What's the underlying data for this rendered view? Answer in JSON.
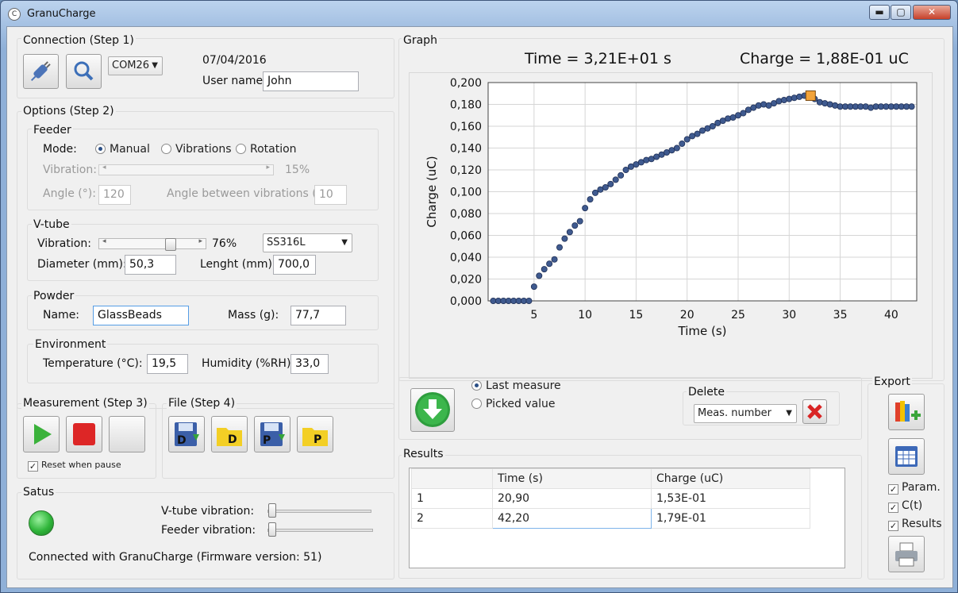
{
  "window": {
    "title": "GranuCharge",
    "icon": "app-icon",
    "min": "▬",
    "max": "▢",
    "close": "✕"
  },
  "connection": {
    "section_label": "Connection (Step 1)",
    "port": "COM26",
    "date": "07/04/2016",
    "username_label": "User name:",
    "username": "John"
  },
  "options": {
    "section_label": "Options (Step 2)",
    "feeder": {
      "label": "Feeder",
      "mode_label": "Mode:",
      "modes": [
        "Manual",
        "Vibrations",
        "Rotation"
      ],
      "selected_mode": "Manual",
      "vibration_label": "Vibration:",
      "vibration_value": "15%",
      "angle_label": "Angle (°):",
      "angle": "120",
      "angle_between_label": "Angle between vibrations (°):",
      "angle_between": "10"
    },
    "vtube": {
      "label": "V-tube",
      "vibration_label": "Vibration:",
      "vibration_value": "76%",
      "vibration_level": 0.76,
      "material": "SS316L",
      "diameter_label": "Diameter (mm):",
      "diameter": "50,3",
      "length_label": "Lenght (mm):",
      "length": "700,0"
    },
    "powder": {
      "label": "Powder",
      "name_label": "Name:",
      "name": "GlassBeads",
      "mass_label": "Mass (g):",
      "mass": "77,7"
    },
    "environment": {
      "label": "Environment",
      "temperature_label": "Temperature (°C):",
      "temperature": "19,5",
      "humidity_label": "Humidity (%RH):",
      "humidity": "33,0"
    }
  },
  "measurement": {
    "section_label": "Measurement (Step 3)",
    "reset_label": "Reset when pause",
    "reset_checked": true
  },
  "file": {
    "section_label": "File (Step 4)",
    "buttons": [
      "D",
      "D",
      "P",
      "P"
    ]
  },
  "status": {
    "section_label": "Satus",
    "vtube_vibration_label": "V-tube vibration:",
    "feeder_vibration_label": "Feeder vibration:",
    "message": "Connected with GranuCharge (Firmware version: 51)",
    "led_color": "#2fb53a"
  },
  "graph": {
    "section_label": "Graph",
    "time_readout": "Time = 3,21E+01 s",
    "charge_readout": "Charge = 1,88E-01 uC"
  },
  "chart_data": {
    "type": "scatter",
    "title": "",
    "xlabel": "Time (s)",
    "ylabel": "Charge (uC)",
    "xlim": [
      0.5,
      42.5
    ],
    "ylim": [
      0,
      0.2
    ],
    "xticks": [
      "5",
      "10",
      "15",
      "20",
      "25",
      "30",
      "35",
      "40"
    ],
    "yticks": [
      "0,000",
      "0,020",
      "0,040",
      "0,060",
      "0,080",
      "0,100",
      "0,120",
      "0,140",
      "0,160",
      "0,180",
      "0,200"
    ],
    "grid": true,
    "marker_color": "#3f5a8f",
    "highlight_color": "#f2a33a",
    "series": [
      {
        "x": [
          1.0,
          1.5,
          2.0,
          2.5,
          3.0,
          3.5,
          4.0,
          4.5,
          5.0,
          5.5,
          6.0,
          6.5,
          7.0,
          7.5,
          8.0,
          8.5,
          9.0,
          9.5,
          10.0,
          10.5,
          11.0,
          11.5,
          12.0,
          12.5,
          13.0,
          13.5,
          14.0,
          14.5,
          15.0,
          15.5,
          16.0,
          16.5,
          17.0,
          17.5,
          18.0,
          18.5,
          19.0,
          19.5,
          20.0,
          20.5,
          21.0,
          21.5,
          22.0,
          22.5,
          23.0,
          23.5,
          24.0,
          24.5,
          25.0,
          25.5,
          26.0,
          26.5,
          27.0,
          27.5,
          28.0,
          28.5,
          29.0,
          29.5,
          30.0,
          30.5,
          31.0,
          31.5,
          32.0,
          32.5,
          33.0,
          33.5,
          34.0,
          34.5,
          35.0,
          35.5,
          36.0,
          36.5,
          37.0,
          37.5,
          38.0,
          38.5,
          39.0,
          39.5,
          40.0,
          40.5,
          41.0,
          41.5,
          42.0
        ],
        "y": [
          0.0,
          0.0,
          0.0,
          0.0,
          0.0,
          0.0,
          0.0,
          0.0,
          0.013,
          0.023,
          0.029,
          0.034,
          0.038,
          0.049,
          0.057,
          0.063,
          0.069,
          0.073,
          0.085,
          0.093,
          0.099,
          0.102,
          0.104,
          0.107,
          0.111,
          0.115,
          0.12,
          0.123,
          0.125,
          0.127,
          0.129,
          0.13,
          0.132,
          0.134,
          0.136,
          0.138,
          0.14,
          0.144,
          0.148,
          0.151,
          0.153,
          0.156,
          0.158,
          0.16,
          0.163,
          0.165,
          0.167,
          0.168,
          0.17,
          0.172,
          0.175,
          0.177,
          0.179,
          0.18,
          0.179,
          0.181,
          0.183,
          0.184,
          0.185,
          0.186,
          0.187,
          0.188,
          0.188,
          0.185,
          0.182,
          0.181,
          0.18,
          0.179,
          0.178,
          0.178,
          0.178,
          0.178,
          0.178,
          0.178,
          0.177,
          0.178,
          0.178,
          0.178,
          0.178,
          0.178,
          0.178,
          0.178,
          0.178
        ]
      }
    ],
    "highlight_point": {
      "x": 32.1,
      "y": 0.188
    }
  },
  "picker": {
    "last_measure_label": "Last measure",
    "picked_value_label": "Picked value",
    "selected": "Last measure",
    "delete_label": "Delete",
    "delete_select": "Meas. number"
  },
  "results": {
    "section_label": "Results",
    "columns": [
      "",
      "Time (s)",
      "Charge (uC)"
    ],
    "rows": [
      [
        "1",
        "20,90",
        "1,53E-01"
      ],
      [
        "2",
        "42,20",
        "1,79E-01"
      ]
    ]
  },
  "export": {
    "section_label": "Export",
    "param_label": "Param.",
    "ct_label": "C(t)",
    "results_label": "Results"
  }
}
